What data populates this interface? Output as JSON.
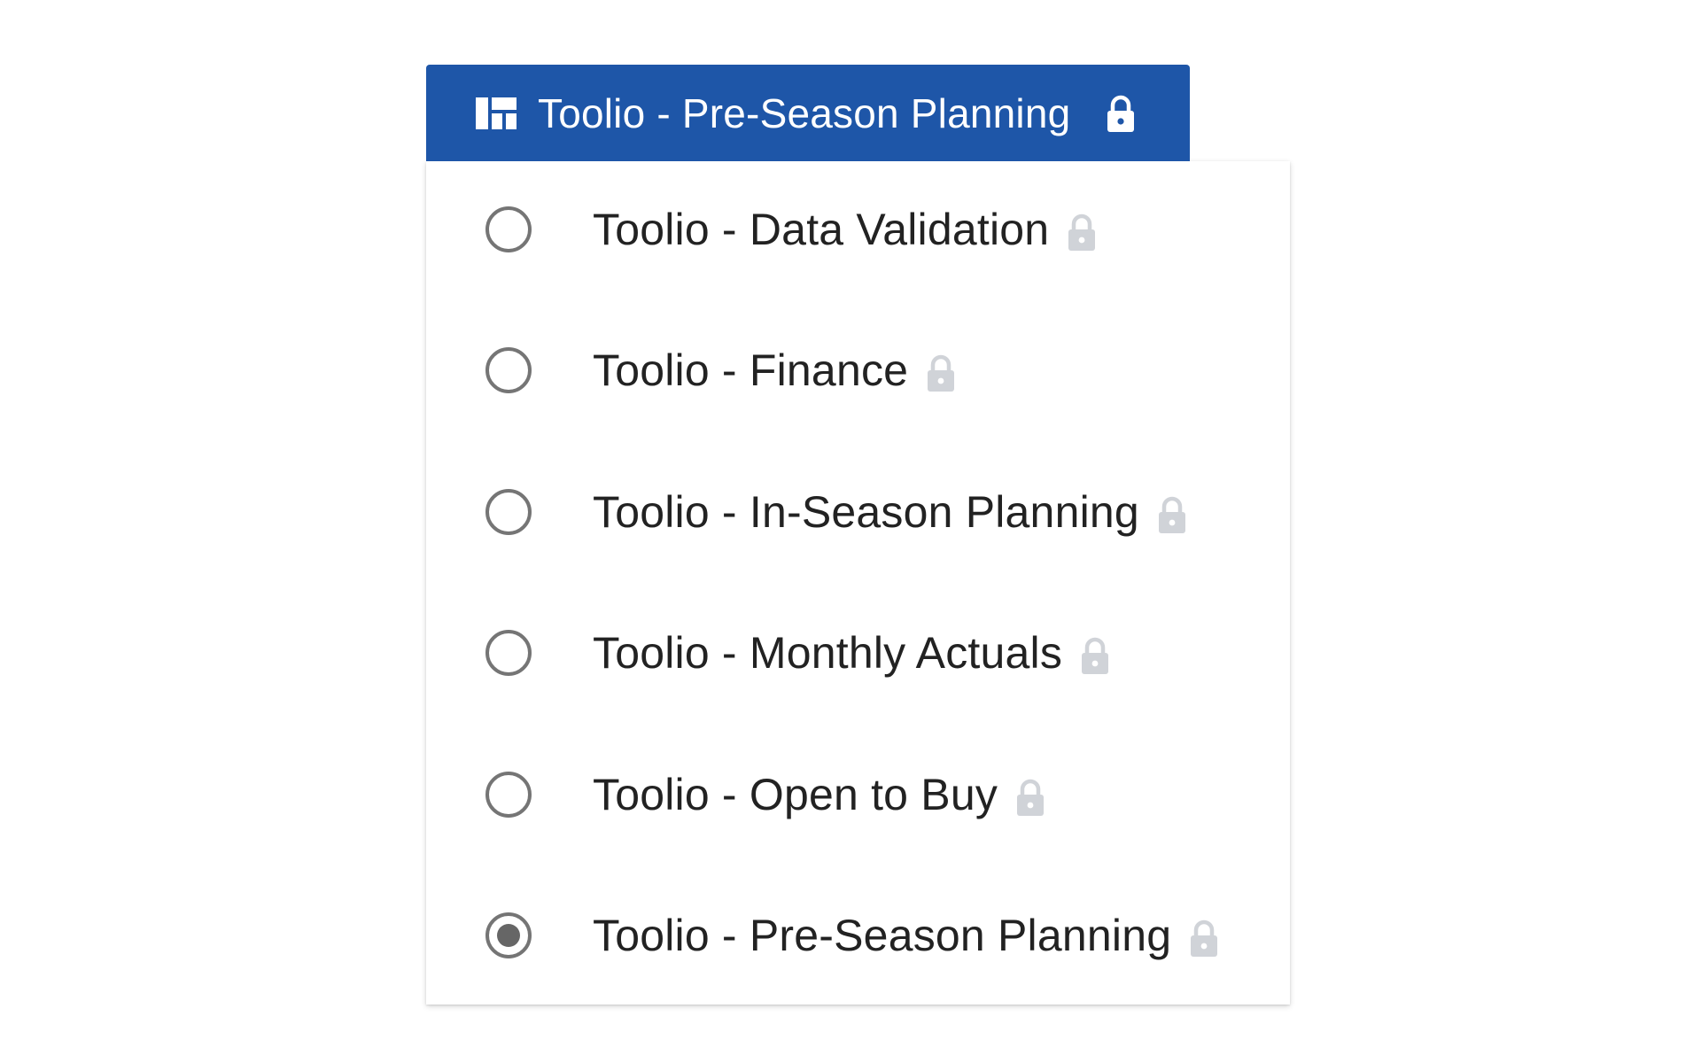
{
  "header": {
    "label": "Toolio - Pre-Season Planning",
    "icon": "dashboard-grid-icon",
    "lock_icon": "lock-icon",
    "background_color": "#1E56A8",
    "text_color": "#FFFFFF"
  },
  "menu": {
    "items": [
      {
        "label": "Toolio - Data Validation",
        "selected": false,
        "locked": true
      },
      {
        "label": "Toolio - Finance",
        "selected": false,
        "locked": true
      },
      {
        "label": "Toolio - In-Season Planning",
        "selected": false,
        "locked": true
      },
      {
        "label": "Toolio - Monthly Actuals",
        "selected": false,
        "locked": true
      },
      {
        "label": "Toolio - Open to Buy",
        "selected": false,
        "locked": true
      },
      {
        "label": "Toolio - Pre-Season Planning",
        "selected": true,
        "locked": true
      }
    ],
    "lock_color": "#D0D3D8",
    "radio_color": "#757575"
  }
}
